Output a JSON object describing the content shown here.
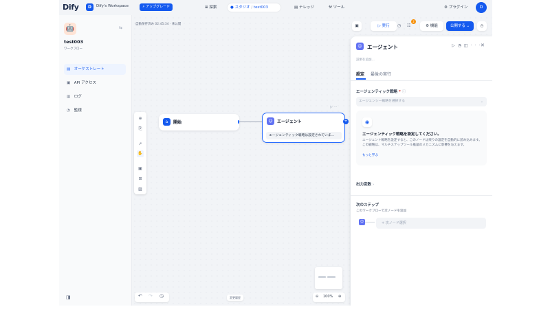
{
  "topbar": {
    "logo": "Dify",
    "workspace_initial": "D",
    "workspace_name": "Dify's Workspace",
    "upgrade_label": "⚡ アップグレード",
    "nav": {
      "explore": "⊞ 探索",
      "studio": "スタジオ",
      "app_crumb": "test003",
      "knowledge": "▤ ナレッジ",
      "tools": "⚒ ツール"
    },
    "plugins": "プラグイン",
    "user_initial": "D"
  },
  "sidebar": {
    "app_name": "test003",
    "app_type": "ワークフロー",
    "items": [
      {
        "icon": "▤",
        "label": "オーケストレート",
        "active": true
      },
      {
        "icon": "▣",
        "label": "API アクセス",
        "active": false
      },
      {
        "icon": "▥",
        "label": "ログ",
        "active": false
      },
      {
        "icon": "◔",
        "label": "監視",
        "active": false
      }
    ]
  },
  "canvas": {
    "autosave": "自動保存済み 02:45:34 · 未公開",
    "start_node": {
      "title": "開始"
    },
    "agent_node": {
      "title": "エージェント",
      "desc": "エージェンティック戦略は設定されていま..."
    },
    "versions_label": "変更履歴",
    "zoom": "100%"
  },
  "actions": {
    "run": "▷ 実行",
    "badge": "2",
    "features": "機能",
    "publish": "公開する ⌄"
  },
  "panel": {
    "title": "エージェント",
    "desc_placeholder": "説明を追加...",
    "tabs": [
      "設定",
      "最後の実行"
    ],
    "strategy_label": "エージェンティック戦略",
    "strategy_placeholder": "エージェンシー戦略を選択する",
    "info_title": "エージェンティック戦略を設定してください。",
    "info_text": "エージェント戦略を設定すると、このノードは残りの設定を自動的に読み込みます。この戦略は、マルチステップツール推論のメカニズムに影響を与えます。",
    "info_link": "もっと学ぶ",
    "output_vars": "出力変数",
    "next_step": "次のステップ",
    "next_step_sub": "このワークフローで次ノードを追加",
    "next_select": "+ 次ノード選択"
  }
}
